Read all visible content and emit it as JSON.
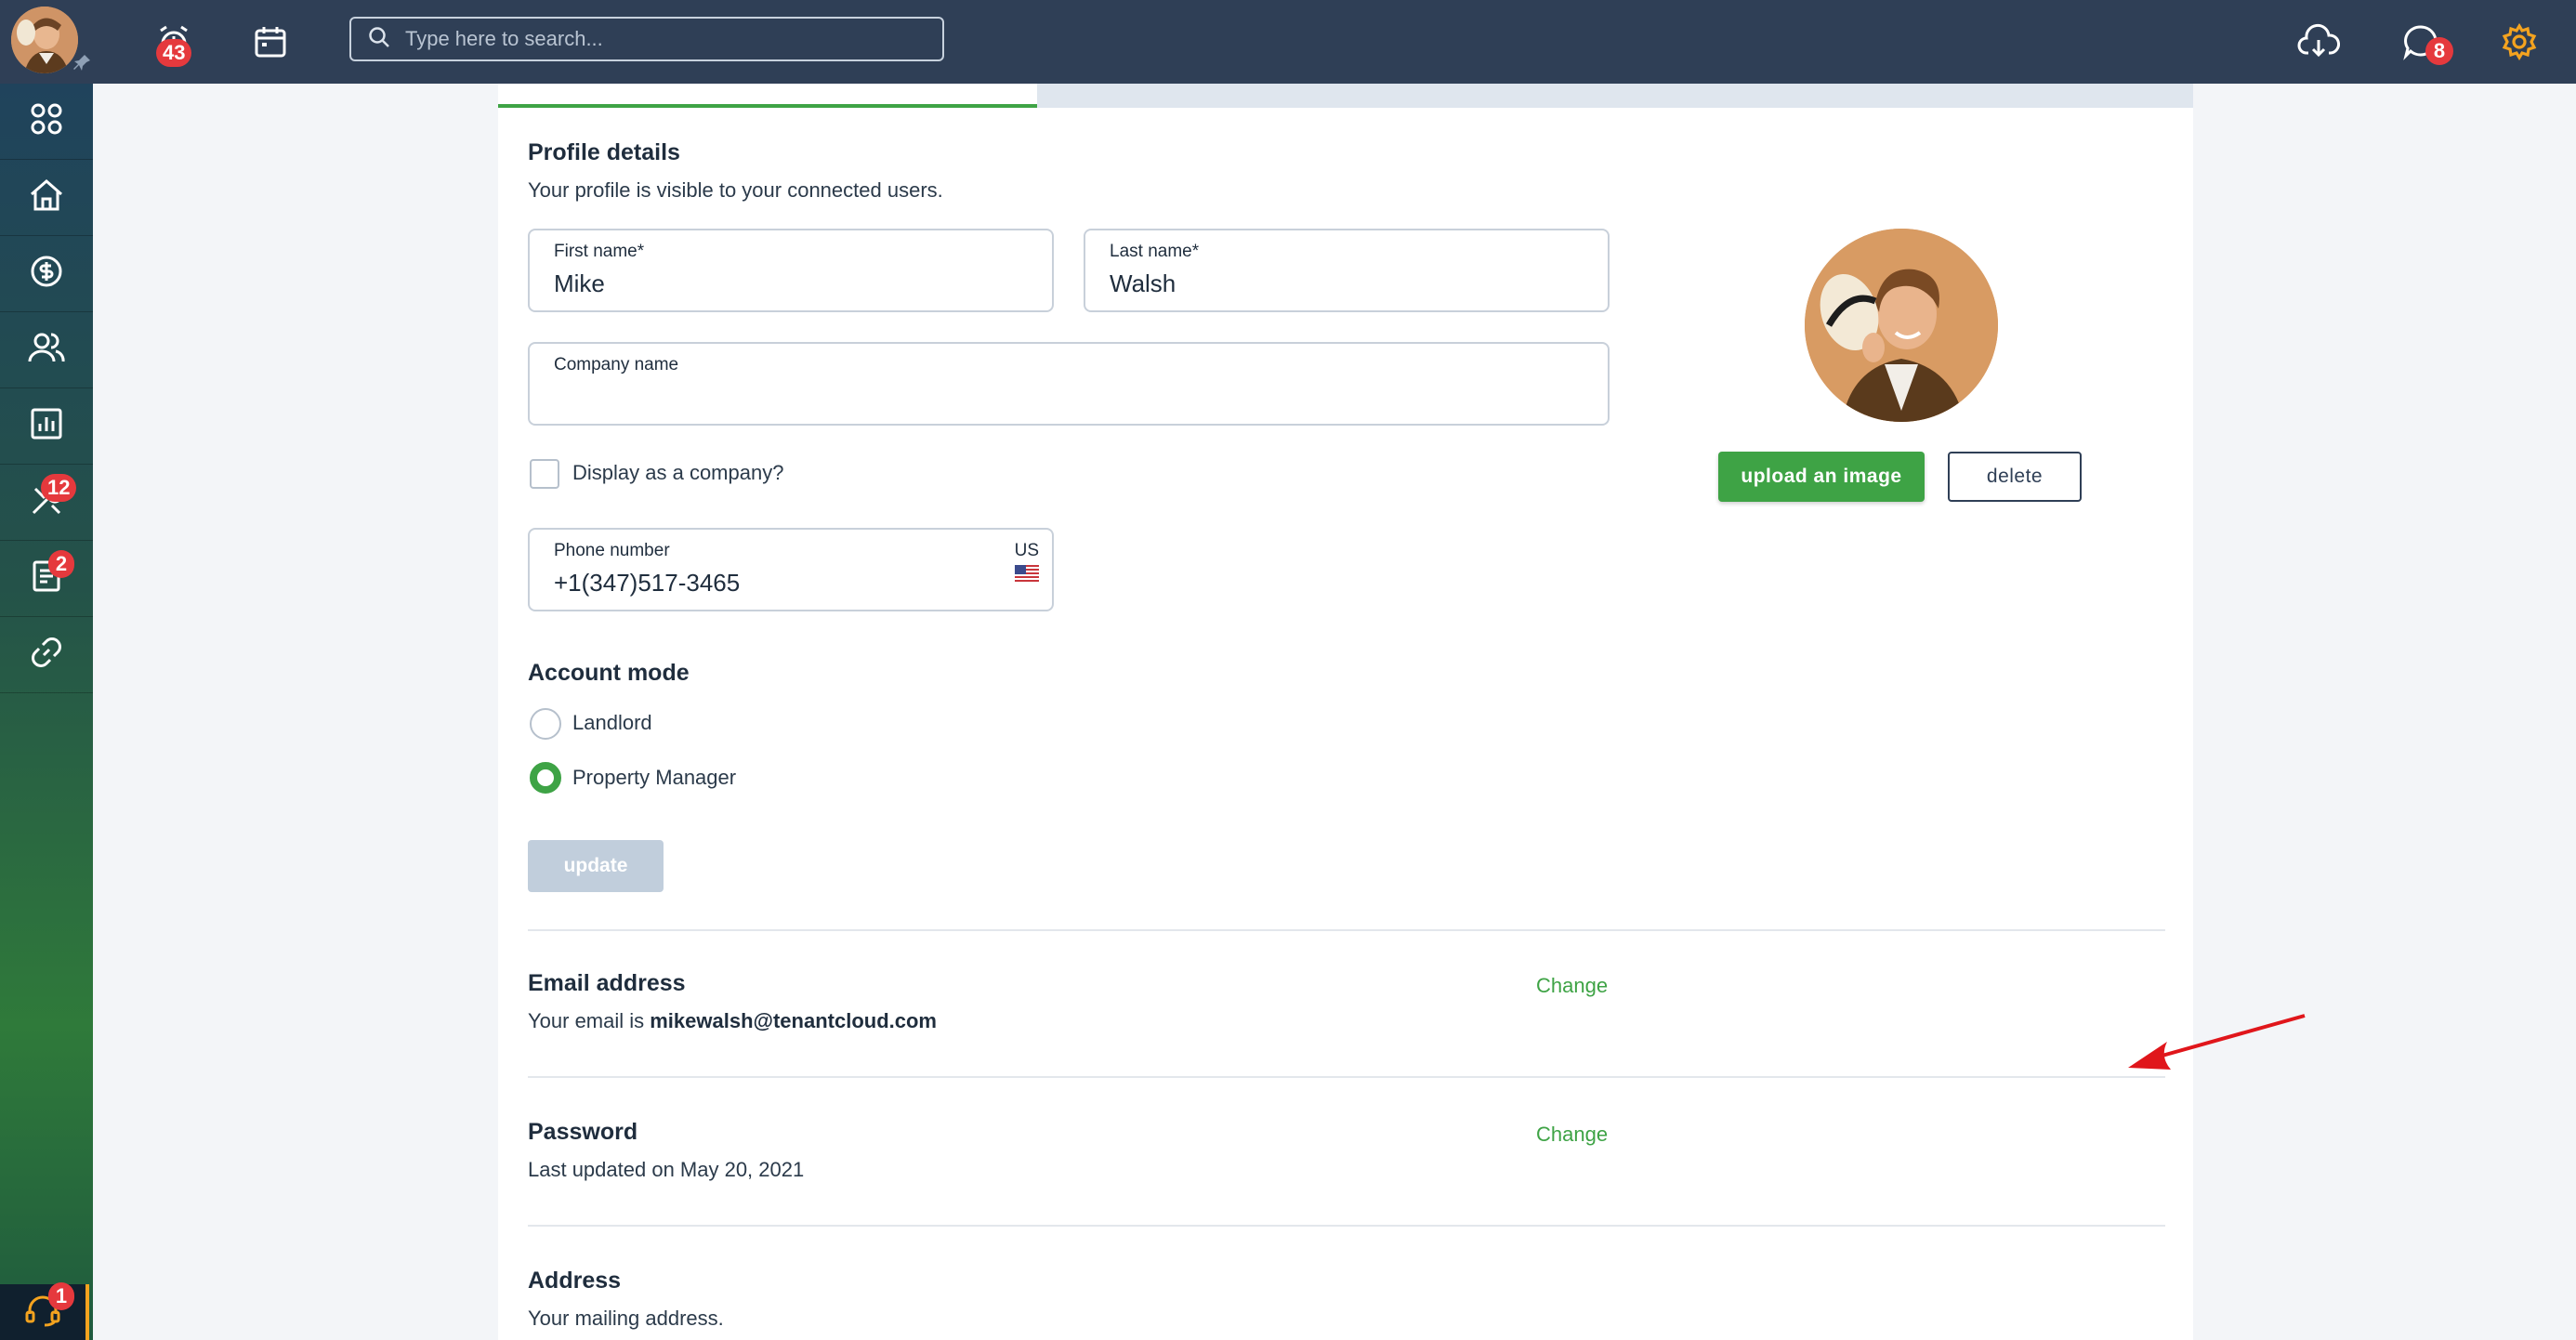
{
  "topbar": {
    "alarm_badge": "43",
    "search_placeholder": "Type here to search...",
    "messages_badge": "8"
  },
  "sidebar": {
    "tools_badge": "12",
    "docs_badge": "2",
    "support_badge": "1"
  },
  "profile": {
    "title": "Profile details",
    "subtitle": "Your profile is visible to your connected users.",
    "first_name_label": "First name*",
    "first_name": "Mike",
    "last_name_label": "Last name*",
    "last_name": "Walsh",
    "company_label": "Company name",
    "company_value": "",
    "display_company_label": "Display as a company?",
    "display_company_checked": false,
    "phone_label": "Phone number",
    "phone_value": "+1(347)517-3465",
    "phone_country": "US",
    "upload_label": "upload an image",
    "delete_label": "delete"
  },
  "account_mode": {
    "title": "Account mode",
    "options": [
      "Landlord",
      "Property Manager"
    ],
    "selected": "Property Manager",
    "update_label": "update"
  },
  "email": {
    "title": "Email address",
    "prefix": "Your email is ",
    "value": "mikewalsh@tenantcloud.com",
    "change_label": "Change"
  },
  "password": {
    "title": "Password",
    "updated": "Last updated on May 20, 2021",
    "change_label": "Change"
  },
  "address": {
    "title": "Address",
    "subtitle": "Your mailing address."
  },
  "colors": {
    "topbar": "#2f3f56",
    "accent_green": "#3ea345",
    "badge_red": "#e5393d",
    "gear_orange": "#f4a31f",
    "annotation_red": "#e0161b"
  }
}
